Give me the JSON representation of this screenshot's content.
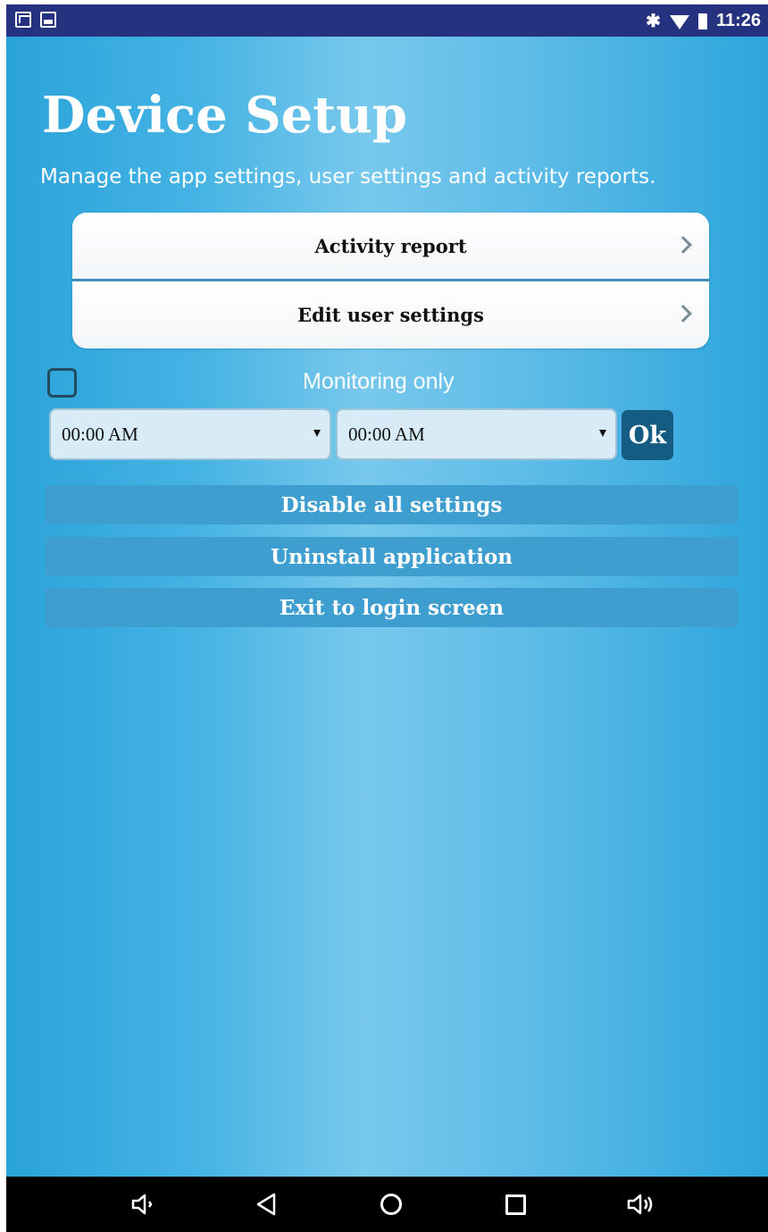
{
  "status_bar": {
    "time": "11:26",
    "left_icons": [
      "gmail-icon",
      "gallery-icon"
    ],
    "right_icons": [
      "bluetooth-icon",
      "wifi-icon",
      "battery-icon"
    ]
  },
  "page": {
    "title": "Device Setup",
    "subtitle": "Manage the app settings, user settings and activity reports."
  },
  "menu": {
    "items": [
      {
        "label": "Activity report",
        "icon": "chevron-right-icon"
      },
      {
        "label": "Edit user settings",
        "icon": "chevron-right-icon"
      }
    ]
  },
  "monitoring": {
    "label": "Monitoring only",
    "checked": false
  },
  "time_range": {
    "start_value": "00:00 AM",
    "end_value": "00:00 AM",
    "ok_label": "Ok"
  },
  "actions": {
    "disable_label": "Disable all settings",
    "uninstall_label": "Uninstall application",
    "exit_label": "Exit to login screen"
  },
  "nav_bar": {
    "icons": [
      "volume-down-icon",
      "back-icon",
      "home-icon",
      "recents-icon",
      "volume-up-icon"
    ]
  },
  "colors": {
    "status_bar": "#25327f",
    "ok_button": "#155c83",
    "action_bar": "#3f9ed0"
  }
}
